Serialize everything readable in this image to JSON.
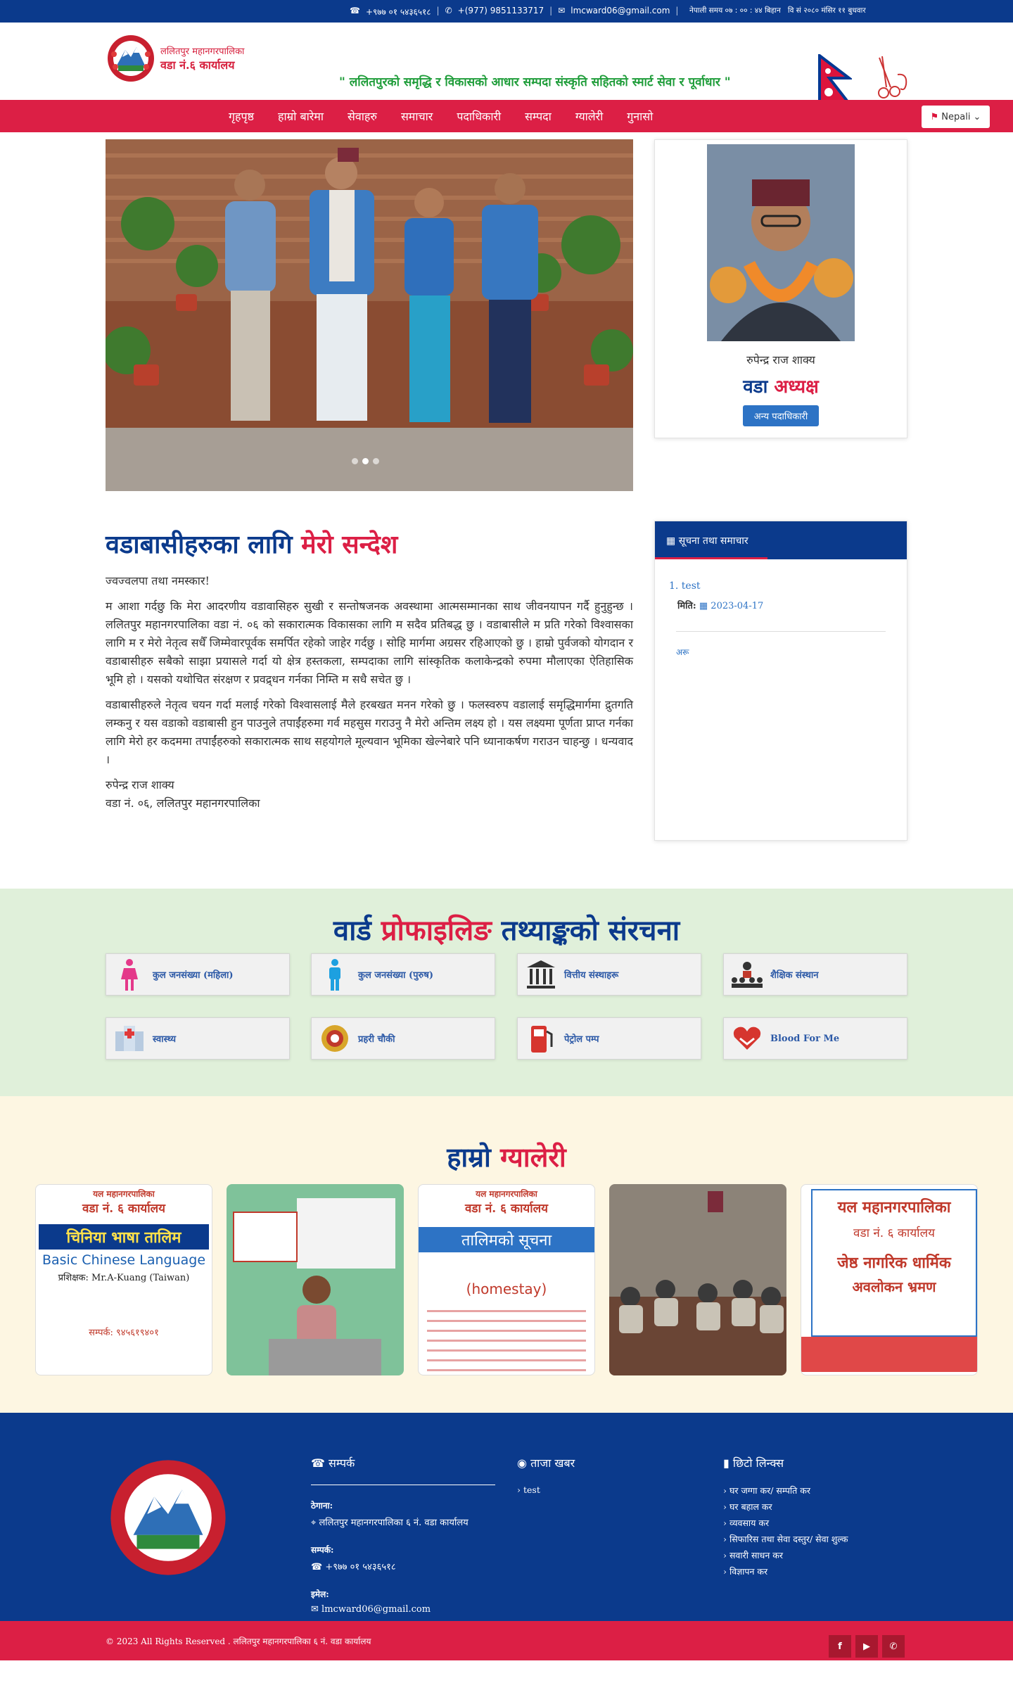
{
  "topbar": {
    "phone": "+९७७ ०१ ५४३६५१८",
    "mobile": "+(977) 9851133717",
    "email": "lmcward06@gmail.com",
    "nepali_time": "नेपाली समय ०७ : ०० : ४४ बिहान",
    "nepali_date": "वि सं २०८० मंसिर ११ बुधवार"
  },
  "header": {
    "logo_line1": "ललितपुर महानगरपालिका",
    "logo_line2": "वडा नं.६ कार्यालय",
    "slogan": "\" ललितपुरको समृद्धि र विकासको आधार सम्पदा संस्कृति सहितको स्मार्ट सेवा र पूर्वाधार \""
  },
  "nav": {
    "items": [
      "गृहपृष्ठ",
      "हाम्रो बारेमा",
      "सेवाहरु",
      "समाचार",
      "पदाधिकारी",
      "सम्पदा",
      "ग्यालेरी",
      "गुनासो"
    ],
    "language": "Nepali"
  },
  "profile": {
    "name": "रुपेन्द्र राज शाक्य",
    "title_a": "वडा",
    "title_b": "अध्यक्ष",
    "button": "अन्य पदाधिकारी"
  },
  "message": {
    "heading_a": "वडाबासीहरुका लागि",
    "heading_b": "मेरो सन्देश",
    "greeting": "ज्वज्वलपा तथा नमस्कार!",
    "para1": "म आशा गर्दछु कि मेरा आदरणीय वडावासिहरु सुखी र सन्तोषजनक अवस्थामा आत्मसम्मानका साथ जीवनयापन गर्दै हुनुहुन्छ । ललितपुर महानगरपालिका वडा नं. ०६ को सकारात्मक विकासका लागि म सदैव प्रतिबद्ध छु । वडाबासीले म प्रति गरेको विश्वासका लागि म र मेरो नेतृत्व सधैँ जिम्मेवारपूर्वक समर्पित रहेको जाहेर गर्दछु । सोहि मार्गमा अग्रसर रहिआएको छु । हाम्रो पुर्वजको योगदान र वडाबासीहरु सबैको साझा प्रयासले गर्दा यो क्षेत्र हस्तकला, सम्पदाका लागि सांस्कृतिक कलाकेन्द्रको रुपमा मौलाएका ऐतिहासिक भूमि हो । यसको यथोचित संरक्षण र प्रवद्र्धन गर्नका निम्ति म सधै सचेत छु ।",
    "para2": "वडाबासीहरुले नेतृत्व चयन गर्दा मलाई गरेको विश्वासलाई मैले हरबखत मनन गरेको छु । फलस्वरुप वडालाई समृद्धिमार्गमा द्रुतगति लम्कनु र यस वडाको वडाबासी हुन पाउनुले तपाईंहरुमा गर्व महसुस गराउनु नै मेरो अन्तिम लक्ष्य हो । यस लक्ष्यमा पूर्णता प्राप्त गर्नका लागि मेरो हर कदममा तपाईंहरुको सकारात्मक साथ सहयोगले मूल्यवान भूमिका खेल्नेबारे पनि ध्यानाकर्षण गराउन चाहन्छु । धन्यवाद ।",
    "sign_name": "रुपेन्द्र राज शाक्य",
    "sign_office": "वडा नं. ०६, ललितपुर महानगरपालिका"
  },
  "notice": {
    "title": "सूचना तथा समाचार",
    "item_title": "1. test",
    "date_label": "मिति:",
    "date": "2023-04-17",
    "more": "अरू"
  },
  "profiling": {
    "heading_a": "वार्ड",
    "heading_b": "प्रोफाइलिङ",
    "heading_c": "तथ्याङ्कको संरचना",
    "cards": [
      {
        "label": "कुल जनसंख्या (महिला)",
        "icon": "female-icon"
      },
      {
        "label": "कुल जनसंख्या (पुरुष)",
        "icon": "male-icon"
      },
      {
        "label": "वित्तीय संस्थाहरू",
        "icon": "bank-icon"
      },
      {
        "label": "शैक्षिक संस्थान",
        "icon": "education-icon"
      },
      {
        "label": "स्वास्थ्य",
        "icon": "hospital-icon"
      },
      {
        "label": "प्रहरी चौकी",
        "icon": "police-icon"
      },
      {
        "label": "पेट्रोल पम्प",
        "icon": "fuel-icon"
      },
      {
        "label": "Blood For Me",
        "icon": "blood-icon"
      }
    ]
  },
  "gallery": {
    "heading_a": "हाम्रो",
    "heading_b": "ग्यालेरी",
    "items": [
      {
        "type": "poster-chinese",
        "t1": "यल महानगरपालिका",
        "t2": "वडा नं. ६ कार्यालय",
        "t3": "चिनिया भाषा तालिम",
        "t4": "Basic Chinese Language",
        "t5": "प्रशिक्षक: Mr.A-Kuang (Taiwan)",
        "t6": "सम्पर्क: ९४५६१९४०१"
      },
      {
        "type": "photo-training"
      },
      {
        "type": "poster-homestay",
        "t1": "यल महानगरपालिका",
        "t2": "वडा नं. ६ कार्यालय",
        "t3": "तालिमको सूचना",
        "t4": "(homestay)"
      },
      {
        "type": "photo-hall"
      },
      {
        "type": "banner-tour",
        "t1": "यल महानगरपालिका",
        "t2": "वडा नं. ६ कार्यालय",
        "t3": "जेष्ठ नागरिक धार्मिक",
        "t4": "अवलोकन भ्रमण"
      }
    ]
  },
  "footer": {
    "contact_title": "सम्पर्क",
    "address_label": "ठेगाना:",
    "address": "ललितपुर महानगरपालिका ६ नं. वडा कार्यालय",
    "phone_label": "सम्पर्क:",
    "phone": "+९७७ ०१ ५४३६५१८",
    "email_label": "इमेल:",
    "email": "lmcward06@gmail.com",
    "news_title": "ताजा खबर",
    "news_items": [
      "test"
    ],
    "links_title": "छिटो लिन्क्स",
    "links": [
      "घर जग्गा कर/ सम्पति कर",
      "घर बहाल कर",
      "व्यवसाय कर",
      "सिफारिस तथा सेवा दस्तुर/ सेवा शुल्क",
      "सवारी साधन कर",
      "विज्ञापन कर"
    ],
    "copyright": "© 2023 All Rights Reserved . ललितपुर महानगरपालिका ६ नं. वडा कार्यालय"
  },
  "colors": {
    "primary_blue": "#0b3a8c",
    "primary_red": "#dc1f45",
    "slogan_green": "#1f9d3a"
  }
}
